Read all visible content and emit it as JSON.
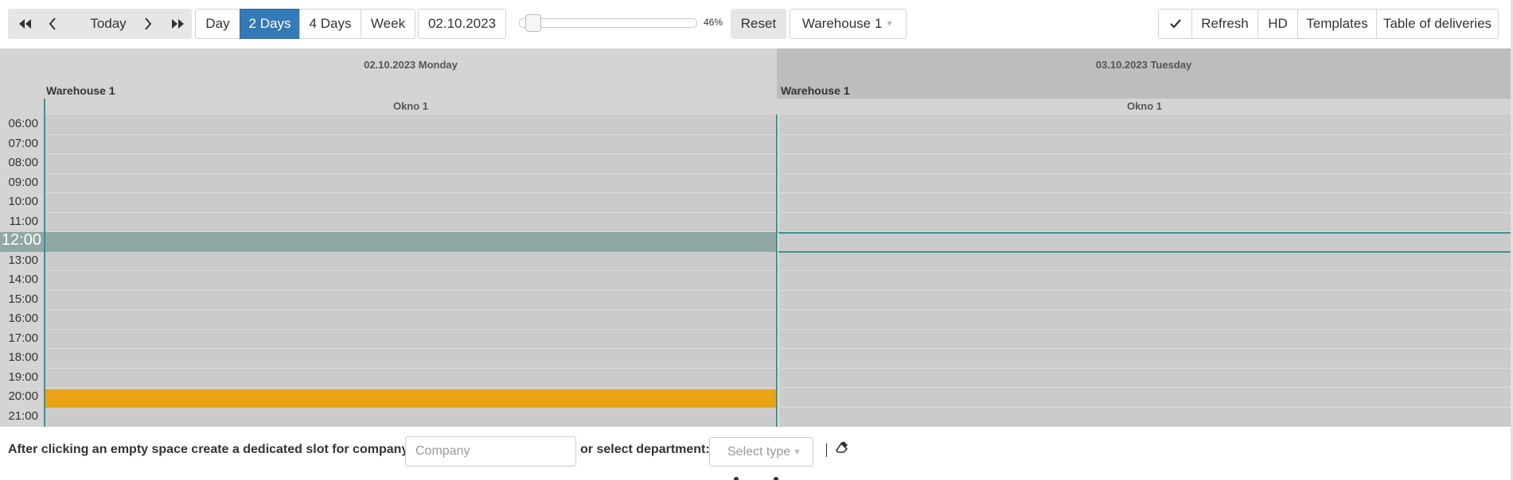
{
  "toolbar": {
    "nav": {
      "today_label": "Today"
    },
    "views": [
      "Day",
      "2 Days",
      "4 Days",
      "Week"
    ],
    "active_view": "2 Days",
    "date_value": "02.10.2023",
    "zoom_text": "46%",
    "zoom_level": 0.46,
    "reset_label": "Reset",
    "warehouse_select": "Warehouse 1",
    "refresh_label": "Refresh",
    "hd_label": "HD",
    "templates_label": "Templates",
    "deliveries_label": "Table of deliveries"
  },
  "calendar": {
    "days": [
      {
        "title": "02.10.2023 Monday",
        "warehouse": "Warehouse 1",
        "window": "Okno 1"
      },
      {
        "title": "03.10.2023 Tuesday",
        "warehouse": "Warehouse 1",
        "window": "Okno 1"
      }
    ],
    "times": [
      "06:00",
      "07:00",
      "08:00",
      "09:00",
      "10:00",
      "11:00",
      "12:00",
      "13:00",
      "14:00",
      "15:00",
      "16:00",
      "17:00",
      "18:00",
      "19:00",
      "20:00",
      "21:00"
    ],
    "current_time": "12:00",
    "highlight_slot_time": "20:00",
    "colors": {
      "current_row": "#8fa8a4",
      "booked_slot": "#e8a317",
      "accent": "#337ab7",
      "divider": "#3f8f8f"
    }
  },
  "footer": {
    "company_prompt": "After clicking an empty space create a dedicated slot for company:",
    "company_placeholder": "Company",
    "department_prompt": "or select department:",
    "type_placeholder": "Select type"
  }
}
